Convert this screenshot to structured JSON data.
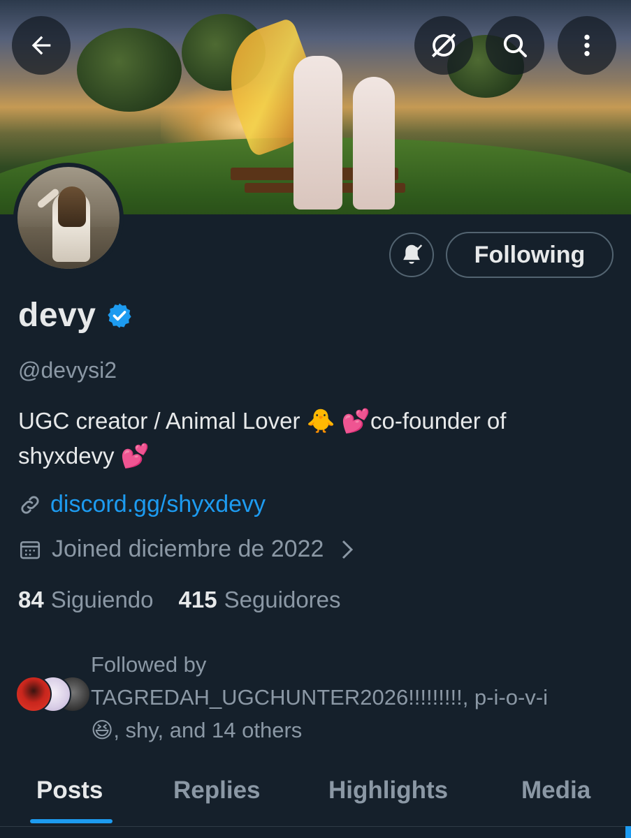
{
  "header": {
    "back_icon": "arrow-left-icon",
    "actions": [
      "hide-retweets-icon",
      "search-icon",
      "more-vertical-icon"
    ]
  },
  "profile": {
    "name": "devy",
    "verified": true,
    "handle": "@devysi2",
    "bio_line1": "UGC creator / Animal Lover 🐥   💕co-founder of",
    "bio_line2": "shyxdevy 💕",
    "link": "discord.gg/shyxdevy",
    "joined": "Joined diciembre de 2022",
    "following_count": "84",
    "following_label": "Siguiendo",
    "followers_count": "415",
    "followers_label": "Seguidores",
    "accent_color": "#1d9bf0"
  },
  "actions": {
    "notify_icon": "bell-check-icon",
    "follow_label": "Following"
  },
  "followed_by": {
    "line1": "Followed by",
    "line2": "TAGREDAH_UGCHUNTER2026!!!!!!!!!, p-i-o-v-i",
    "line3": "😆, shy, and 14 others"
  },
  "tabs": [
    {
      "label": "Posts",
      "active": true
    },
    {
      "label": "Replies",
      "active": false
    },
    {
      "label": "Highlights",
      "active": false
    },
    {
      "label": "Media",
      "active": false
    }
  ]
}
